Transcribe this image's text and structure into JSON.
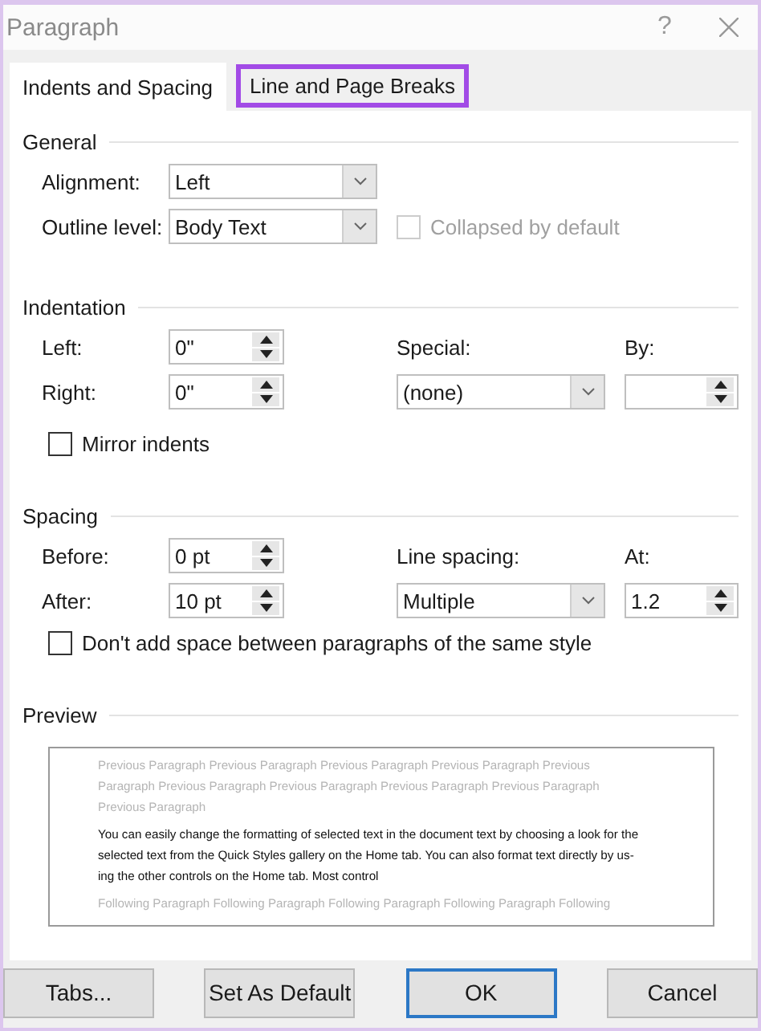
{
  "window": {
    "title": "Paragraph",
    "help": "?"
  },
  "tabs": [
    {
      "label": "Indents and Spacing",
      "selected": true,
      "highlighted": false
    },
    {
      "label": "Line and Page Breaks",
      "selected": false,
      "highlighted": true
    }
  ],
  "general": {
    "heading": "General",
    "alignment": {
      "label": "Alignment:",
      "value": "Left"
    },
    "outline_level": {
      "label": "Outline level:",
      "value": "Body Text"
    },
    "collapsed": {
      "label": "Collapsed by default",
      "checked": false,
      "disabled": true
    }
  },
  "indentation": {
    "heading": "Indentation",
    "left": {
      "label": "Left:",
      "value": "0\""
    },
    "right": {
      "label": "Right:",
      "value": "0\""
    },
    "special": {
      "label": "Special:",
      "value": "(none)"
    },
    "by": {
      "label": "By:"
    },
    "mirror": {
      "label": "Mirror indents",
      "checked": false,
      "disabled": false
    }
  },
  "spacing": {
    "heading": "Spacing",
    "before": {
      "label": "Before:",
      "value": "0 pt"
    },
    "after": {
      "label": "After:",
      "value": "10 pt"
    },
    "line_spacing": {
      "label": "Line spacing:",
      "value": "Multiple"
    },
    "at": {
      "label": "At:",
      "value": "1.2"
    },
    "dont_add": {
      "label": "Don't add space between paragraphs of the same style",
      "checked": false,
      "disabled": false
    }
  },
  "preview": {
    "heading": "Preview",
    "previous": "Previous Paragraph Previous Paragraph Previous Paragraph Previous Paragraph Previous Paragraph Previous Paragraph Previous Paragraph Previous Paragraph Previous Paragraph Previous Paragraph",
    "current": "You can easily change the formatting of selected text in the document text by choosing a look for the selected text from the Quick Styles gallery on the Home tab. You can also format text directly by us-ing the other controls on the Home tab. Most control",
    "following": "Following Paragraph Following Paragraph Following Paragraph Following Paragraph Following"
  },
  "buttons": [
    {
      "label": "Tabs...",
      "default": false
    },
    {
      "label": "Set As Default",
      "default": false
    },
    {
      "label": "OK",
      "default": true
    },
    {
      "label": "Cancel",
      "default": false
    }
  ]
}
